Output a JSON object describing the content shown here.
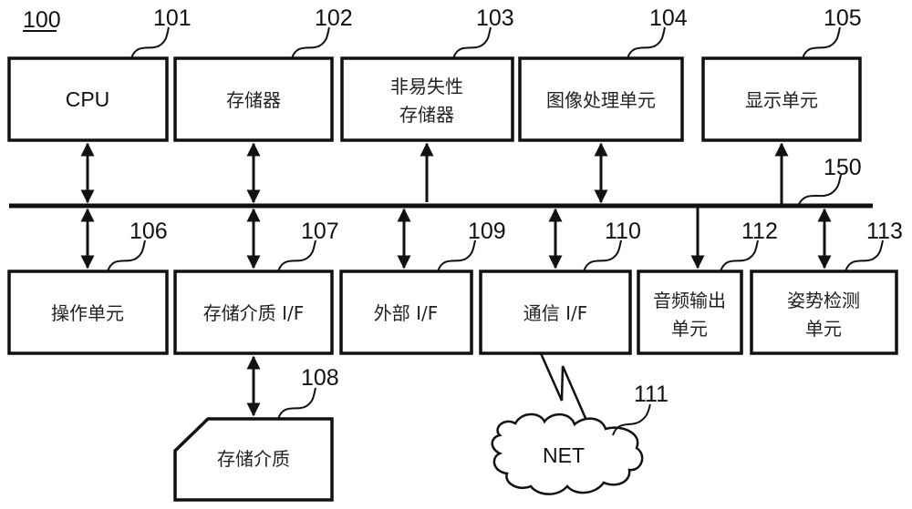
{
  "figure": {
    "ref": "100",
    "bus": {
      "ref": "150"
    },
    "blocks": [
      {
        "id": "cpu",
        "ref": "101",
        "lines": [
          "CPU"
        ]
      },
      {
        "id": "memory",
        "ref": "102",
        "lines": [
          "存储器"
        ]
      },
      {
        "id": "nonvolatile-memory",
        "ref": "103",
        "lines": [
          "非易失性",
          "存储器"
        ]
      },
      {
        "id": "image-processing-unit",
        "ref": "104",
        "lines": [
          "图像处理单元"
        ]
      },
      {
        "id": "display-unit",
        "ref": "105",
        "lines": [
          "显示单元"
        ]
      },
      {
        "id": "operation-unit",
        "ref": "106",
        "lines": [
          "操作单元"
        ]
      },
      {
        "id": "storage-medium-if",
        "ref": "107",
        "lines": [
          "存储介质 I/F"
        ]
      },
      {
        "id": "storage-medium",
        "ref": "108",
        "lines": [
          "存储介质"
        ]
      },
      {
        "id": "external-if",
        "ref": "109",
        "lines": [
          "外部 I/F"
        ]
      },
      {
        "id": "communication-if",
        "ref": "110",
        "lines": [
          "通信 I/F"
        ]
      },
      {
        "id": "network",
        "ref": "111",
        "lines": [
          "NET"
        ]
      },
      {
        "id": "audio-output-unit",
        "ref": "112",
        "lines": [
          "音频输出",
          "单元"
        ]
      },
      {
        "id": "attitude-detection-unit",
        "ref": "113",
        "lines": [
          "姿势检测",
          "单元"
        ]
      }
    ],
    "connections": [
      {
        "from": "cpu",
        "to": "bus",
        "direction": "bidirectional"
      },
      {
        "from": "memory",
        "to": "bus",
        "direction": "bidirectional"
      },
      {
        "from": "nonvolatile-memory",
        "to": "bus",
        "direction": "to-bus"
      },
      {
        "from": "image-processing-unit",
        "to": "bus",
        "direction": "bidirectional"
      },
      {
        "from": "bus",
        "to": "display-unit",
        "direction": "to-block"
      },
      {
        "from": "operation-unit",
        "to": "bus",
        "direction": "bidirectional"
      },
      {
        "from": "storage-medium-if",
        "to": "bus",
        "direction": "bidirectional"
      },
      {
        "from": "storage-medium-if",
        "to": "storage-medium",
        "direction": "bidirectional"
      },
      {
        "from": "external-if",
        "to": "bus",
        "direction": "bidirectional"
      },
      {
        "from": "communication-if",
        "to": "bus",
        "direction": "bidirectional"
      },
      {
        "from": "communication-if",
        "to": "network",
        "direction": "wireless"
      },
      {
        "from": "bus",
        "to": "audio-output-unit",
        "direction": "to-block"
      },
      {
        "from": "attitude-detection-unit",
        "to": "bus",
        "direction": "bidirectional"
      }
    ]
  }
}
